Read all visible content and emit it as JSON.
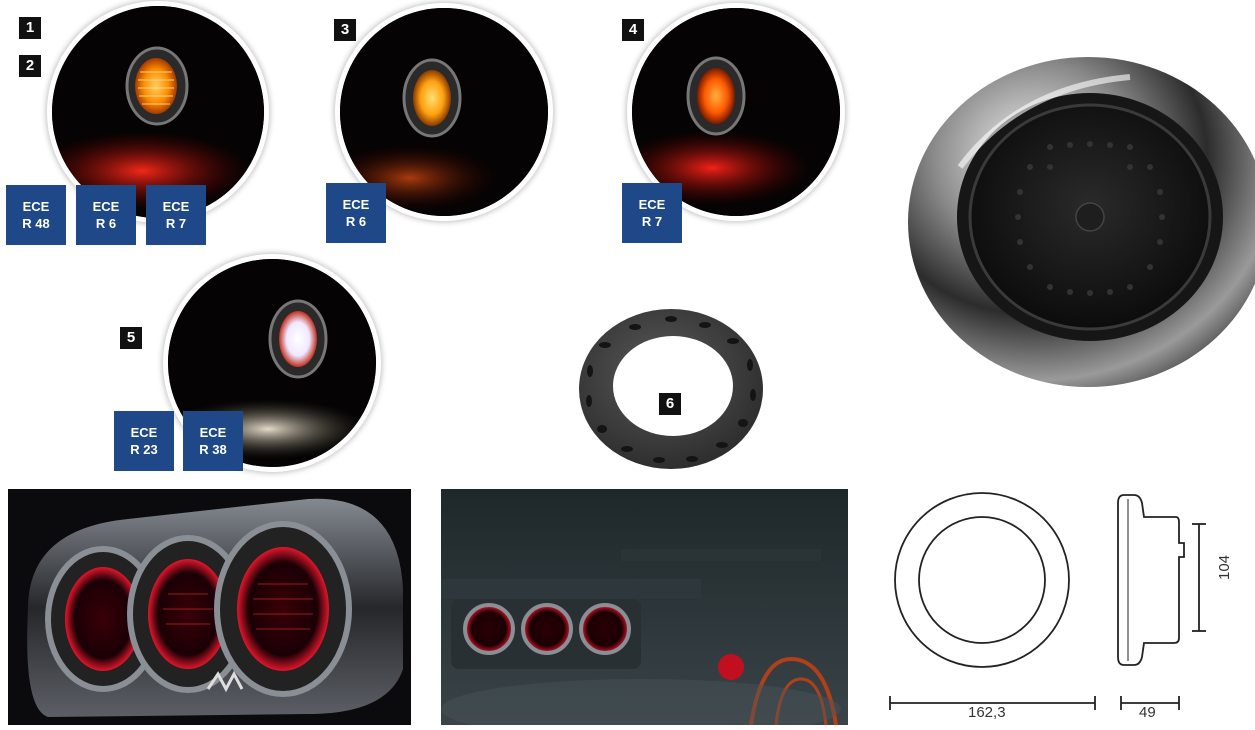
{
  "badges": {
    "b1": "1",
    "b2": "2",
    "b3": "3",
    "b4": "4",
    "b5": "5",
    "b6": "6"
  },
  "ece": {
    "prefix": "ECE",
    "photo1": [
      "R 48",
      "R 6",
      "R 7"
    ],
    "photo3": [
      "R 6"
    ],
    "photo4": [
      "R 7"
    ],
    "photo5": [
      "R 23",
      "R 38"
    ]
  },
  "dimensions": {
    "width": "162,3",
    "height": "104",
    "depth": "49"
  },
  "colors": {
    "badge_bg": "#111111",
    "ece_bg": "#1f4888",
    "amber": "#ff8a00",
    "red_led": "#e0162b",
    "white_led": "#fff6ee"
  }
}
